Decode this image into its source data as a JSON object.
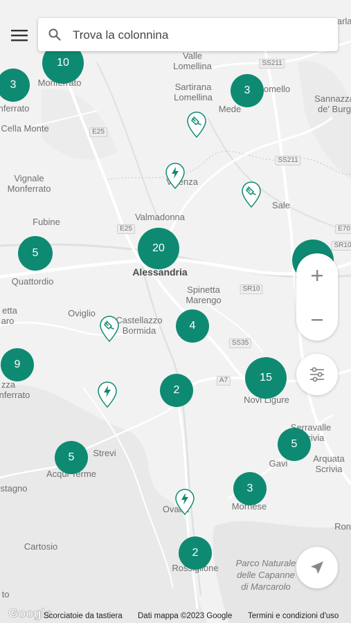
{
  "search": {
    "placeholder": "Trova la colonnina"
  },
  "places": {
    "valle": "Valle",
    "lomellina1": "Lomellina",
    "sartirana": "Sartirana",
    "lomellina2": "Lomellina",
    "mede": "Mede",
    "omello": "omello",
    "sannazzaro": "Sannazza",
    "deburg": "de' Burg",
    "monferrato_tl": "Monferrato",
    "nferrato": "nferrato",
    "cella": "Cella Monte",
    "vignale1": "Vignale",
    "vignale2": "Monferrato",
    "valenza": "Valenza",
    "sale": "Sale",
    "fubine": "Fubine",
    "valmadonna": "Valmadonna",
    "alessandria": "Alessandria",
    "quattordio": "Quattordio",
    "spinetta1": "Spinetta",
    "spinetta2": "Marengo",
    "etta": "etta",
    "aro": "aro",
    "oviglio": "Oviglio",
    "castellazzo1": "Castellazzo",
    "castellazzo2": "Bormida",
    "novi": "Novi Ligure",
    "zza": "zza",
    "nferrato2": "nferrato",
    "serravalle1": "Serravalle",
    "serravalle2": "Scrivia",
    "arquata1": "Arquata",
    "arquata2": "Scrivia",
    "gavi": "Gavi",
    "strevi": "Strevi",
    "acqui": "Acqui Terme",
    "stagno": "stagno",
    "ovada": "Ovada",
    "mornese": "Mornese",
    "ron": "Ron",
    "cartosio": "Cartosio",
    "rossiglione": "Rossiglione",
    "parco1": "Parco Naturale",
    "parco2": "delle Capanne",
    "parco3": "di Marcarolo",
    "carla": "Carla",
    "to": "to"
  },
  "road_shields": [
    "SS211",
    "SS211",
    "E25",
    "E25",
    "E70",
    "SR10",
    "SR10",
    "SS35",
    "A7"
  ],
  "clusters": [
    {
      "id": "monferrato",
      "count": "10"
    },
    {
      "id": "west-top",
      "count": "3"
    },
    {
      "id": "mede",
      "count": "3"
    },
    {
      "id": "quattordio",
      "count": "5"
    },
    {
      "id": "alessandria",
      "count": "20"
    },
    {
      "id": "east-edge",
      "count": ""
    },
    {
      "id": "castellazzo",
      "count": "4"
    },
    {
      "id": "west-mid",
      "count": "9"
    },
    {
      "id": "novi",
      "count": "15"
    },
    {
      "id": "south",
      "count": "2"
    },
    {
      "id": "gavi",
      "count": "5"
    },
    {
      "id": "acqui",
      "count": "5"
    },
    {
      "id": "mornese",
      "count": "3"
    },
    {
      "id": "rossiglione",
      "count": "2"
    }
  ],
  "station_pins": [
    {
      "id": "sartirana",
      "type": "plug-icon"
    },
    {
      "id": "valenza",
      "type": "bolt-icon"
    },
    {
      "id": "sale",
      "type": "plug-icon"
    },
    {
      "id": "castellazzo",
      "type": "plug-icon"
    },
    {
      "id": "strevi",
      "type": "bolt-icon"
    },
    {
      "id": "ovada",
      "type": "bolt-icon"
    }
  ],
  "footer": {
    "logo": "Google",
    "shortcuts": "Scorciatoie da tastiera",
    "map_data": "Dati mappa ©2023 Google",
    "terms": "Termini e condizioni d'uso"
  },
  "colors": {
    "accent": "#0e8a72",
    "map_bg": "#f2f2f2",
    "road": "#ffffff",
    "water": "#dfe3e6"
  }
}
